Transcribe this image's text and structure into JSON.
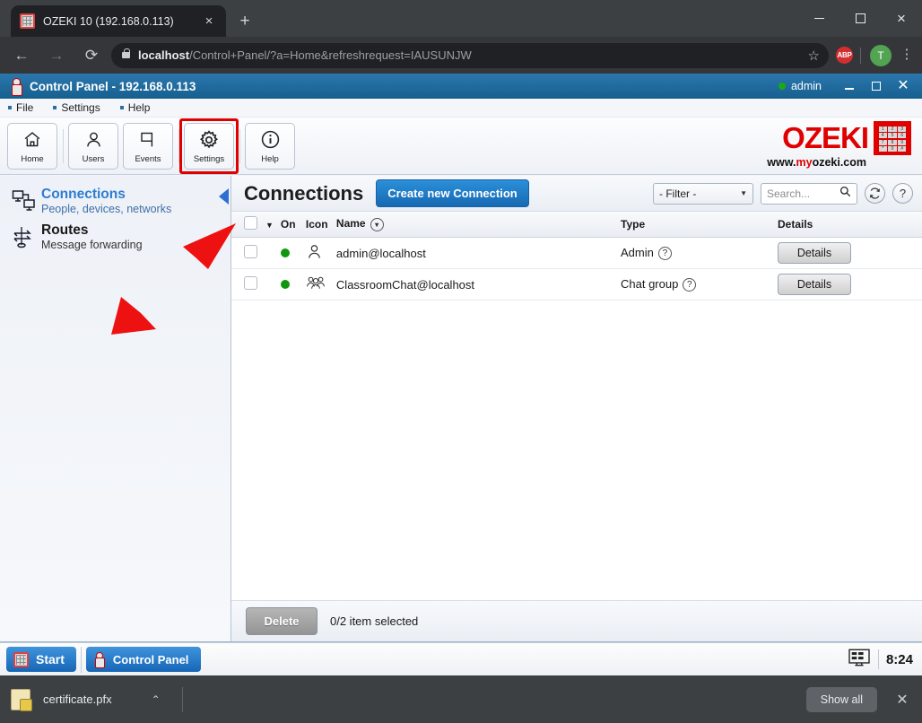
{
  "browser": {
    "tab": {
      "title": "OZEKI 10 (192.168.0.113)",
      "favicon": "ozeki-grid-icon",
      "close": "×"
    },
    "new_tab_label": "+",
    "window_controls": {
      "minimize": "minimize-icon",
      "maximize": "maximize-icon",
      "close": "×"
    },
    "nav": {
      "back": "←",
      "forward": "→",
      "reload": "⟳"
    },
    "address": {
      "lock": "lock-icon",
      "host": "localhost",
      "path": "/Control+Panel/?a=Home&refreshrequest=IAUSUNJW",
      "bookmark_star": "☆"
    },
    "extensions": {
      "abp_label": "ABP"
    },
    "profile_initial": "T",
    "menu_dots": "⋮"
  },
  "app": {
    "title": "Control Panel - 192.168.0.113",
    "user": "admin",
    "window_controls": {
      "minimize": "minimize-icon",
      "maximize": "maximize-icon",
      "close": "✕"
    },
    "menus": [
      {
        "label": "File"
      },
      {
        "label": "Settings"
      },
      {
        "label": "Help"
      }
    ],
    "toolbar": [
      {
        "label": "Home",
        "icon": "home-icon",
        "highlighted": false
      },
      {
        "label": "Users",
        "icon": "user-icon",
        "highlighted": false
      },
      {
        "label": "Events",
        "icon": "flag-icon",
        "highlighted": false
      },
      {
        "label": "Settings",
        "icon": "gear-icon",
        "highlighted": true
      },
      {
        "label": "Help",
        "icon": "info-icon",
        "highlighted": false
      }
    ],
    "logo": {
      "text": "OZEKI",
      "sub_prefix": "www.",
      "sub_red": "my",
      "sub_suffix": "ozeki.com",
      "keys": [
        "1",
        "2",
        "3",
        "4",
        "5",
        "6",
        "7",
        "8",
        "9",
        "*",
        "0",
        "#"
      ]
    },
    "highlight_color": "#e00000",
    "accent_color": "#1769b3"
  },
  "sidebar": {
    "items": [
      {
        "title": "Connections",
        "subtitle": "People, devices, networks",
        "icon": "connections-icon",
        "active": true
      },
      {
        "title": "Routes",
        "subtitle": "Message forwarding",
        "icon": "routes-icon",
        "active": false
      }
    ],
    "collapse_handle": "collapse-triangle-icon"
  },
  "main": {
    "page_title": "Connections",
    "create_button": "Create new Connection",
    "filter": {
      "selected": "- Filter -",
      "caret": "▼"
    },
    "search": {
      "value": "",
      "placeholder": "Search...",
      "icon": "magnifier-icon"
    },
    "refresh_icon": "refresh-icon",
    "help_icon": "question-icon",
    "table": {
      "columns": [
        "",
        "",
        "On",
        "Icon",
        "Name",
        "Type",
        "Details"
      ],
      "name_sort_icon": "sort-chevron-icon",
      "rows": [
        {
          "checked": false,
          "status": "online",
          "icon": "person-icon",
          "name": "admin@localhost",
          "type": "Admin",
          "type_help": "?",
          "details_label": "Details"
        },
        {
          "checked": false,
          "status": "online",
          "icon": "group-icon",
          "name": "ClassroomChat@localhost",
          "type": "Chat group",
          "type_help": "?",
          "details_label": "Details"
        }
      ]
    },
    "footer": {
      "delete_label": "Delete",
      "selection_text": "0/2 item selected"
    }
  },
  "annotation": {
    "arrow": "red-arrow-pointing-to-settings",
    "color": "#ee1111"
  },
  "taskbar": {
    "start_label": "Start",
    "items": [
      {
        "label": "Control Panel",
        "icon": "ozeki-icon"
      }
    ],
    "tray_icon": "display-icon",
    "clock": "8:24"
  },
  "download_bar": {
    "file_name": "certificate.pfx",
    "file_icon": "certificate-icon",
    "caret": "⌃",
    "show_all_label": "Show all",
    "close": "✕"
  }
}
